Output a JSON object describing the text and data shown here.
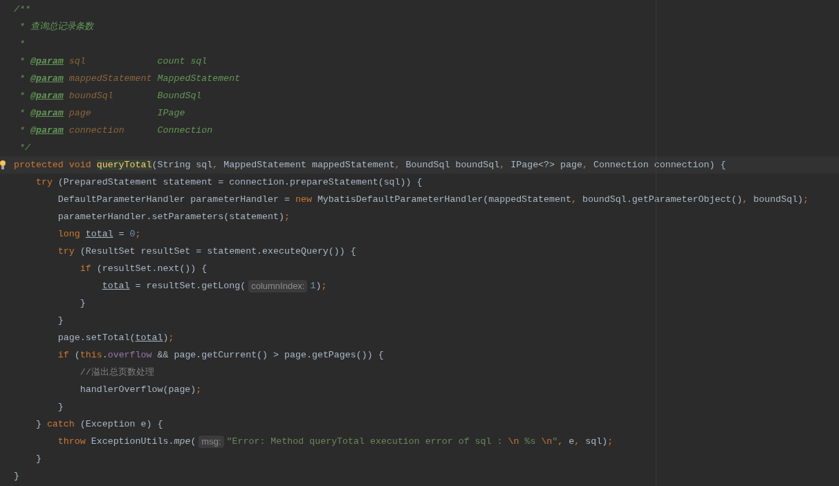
{
  "editor": {
    "lines": [
      {
        "current": false,
        "tokens": [
          {
            "text": "/**",
            "kind": "doc"
          }
        ]
      },
      {
        "current": false,
        "tokens": [
          {
            "text": " * 查询总记录条数",
            "kind": "doc"
          }
        ]
      },
      {
        "current": false,
        "tokens": [
          {
            "text": " *",
            "kind": "doc"
          }
        ]
      },
      {
        "current": false,
        "tokens": [
          {
            "text": " * ",
            "kind": "doc"
          },
          {
            "text": "@param",
            "kind": "tag"
          },
          {
            "text": " sql             ",
            "kind": "pname"
          },
          {
            "text": "count sql",
            "kind": "doc"
          }
        ]
      },
      {
        "current": false,
        "tokens": [
          {
            "text": " * ",
            "kind": "doc"
          },
          {
            "text": "@param",
            "kind": "tag"
          },
          {
            "text": " mappedStatement ",
            "kind": "pname"
          },
          {
            "text": "MappedStatement",
            "kind": "doc"
          }
        ]
      },
      {
        "current": false,
        "tokens": [
          {
            "text": " * ",
            "kind": "doc"
          },
          {
            "text": "@param",
            "kind": "tag"
          },
          {
            "text": " boundSql        ",
            "kind": "pname"
          },
          {
            "text": "BoundSql",
            "kind": "doc"
          }
        ]
      },
      {
        "current": false,
        "tokens": [
          {
            "text": " * ",
            "kind": "doc"
          },
          {
            "text": "@param",
            "kind": "tag"
          },
          {
            "text": " page            ",
            "kind": "pname"
          },
          {
            "text": "IPage",
            "kind": "doc"
          }
        ]
      },
      {
        "current": false,
        "tokens": [
          {
            "text": " * ",
            "kind": "doc"
          },
          {
            "text": "@param",
            "kind": "tag"
          },
          {
            "text": " connection      ",
            "kind": "pname"
          },
          {
            "text": "Connection",
            "kind": "doc"
          }
        ]
      },
      {
        "current": false,
        "tokens": [
          {
            "text": " */",
            "kind": "doc"
          }
        ]
      },
      {
        "current": true,
        "tokens": [
          {
            "text": "protected void ",
            "kind": "kw"
          },
          {
            "text": "queryTotal",
            "kind": "decl"
          },
          {
            "text": "(String sql",
            "kind": "plain"
          },
          {
            "text": ", ",
            "kind": "kw"
          },
          {
            "text": "MappedStatement mappedStatement",
            "kind": "plain"
          },
          {
            "text": ", ",
            "kind": "kw"
          },
          {
            "text": "BoundSql boundSql",
            "kind": "plain"
          },
          {
            "text": ", ",
            "kind": "kw"
          },
          {
            "text": "IPage<?> page",
            "kind": "plain"
          },
          {
            "text": ", ",
            "kind": "kw"
          },
          {
            "text": "Connection connection) {",
            "kind": "plain"
          }
        ]
      },
      {
        "current": false,
        "tokens": [
          {
            "text": "    try ",
            "kind": "kw"
          },
          {
            "text": "(PreparedStatement statement = connection.prepareStatement(sql)) {",
            "kind": "plain"
          }
        ]
      },
      {
        "current": false,
        "tokens": [
          {
            "text": "        DefaultParameterHandler parameterHandler = ",
            "kind": "plain"
          },
          {
            "text": "new ",
            "kind": "kw"
          },
          {
            "text": "MybatisDefaultParameterHandler(mappedStatement",
            "kind": "plain"
          },
          {
            "text": ", ",
            "kind": "kw"
          },
          {
            "text": "boundSql.getParameterObject()",
            "kind": "plain"
          },
          {
            "text": ", ",
            "kind": "kw"
          },
          {
            "text": "boundSql)",
            "kind": "plain"
          },
          {
            "text": ";",
            "kind": "kw"
          }
        ]
      },
      {
        "current": false,
        "tokens": [
          {
            "text": "        parameterHandler.setParameters(statement)",
            "kind": "plain"
          },
          {
            "text": ";",
            "kind": "kw"
          }
        ]
      },
      {
        "current": false,
        "tokens": [
          {
            "text": "        long ",
            "kind": "kw"
          },
          {
            "text": "total",
            "kind": "var"
          },
          {
            "text": " = ",
            "kind": "plain"
          },
          {
            "text": "0",
            "kind": "num"
          },
          {
            "text": ";",
            "kind": "kw"
          }
        ]
      },
      {
        "current": false,
        "tokens": [
          {
            "text": "        try ",
            "kind": "kw"
          },
          {
            "text": "(ResultSet resultSet = statement.executeQuery()) {",
            "kind": "plain"
          }
        ]
      },
      {
        "current": false,
        "tokens": [
          {
            "text": "            if ",
            "kind": "kw"
          },
          {
            "text": "(resultSet.next()) {",
            "kind": "plain"
          }
        ]
      },
      {
        "current": false,
        "tokens": [
          {
            "text": "                total",
            "kind": "var"
          },
          {
            "text": " = resultSet.getLong(",
            "kind": "plain"
          },
          {
            "text": "columnIndex:",
            "kind": "hint"
          },
          {
            "text": "1",
            "kind": "num"
          },
          {
            "text": ")",
            "kind": "plain"
          },
          {
            "text": ";",
            "kind": "kw"
          }
        ]
      },
      {
        "current": false,
        "tokens": [
          {
            "text": "            }",
            "kind": "plain"
          }
        ]
      },
      {
        "current": false,
        "tokens": [
          {
            "text": "        }",
            "kind": "plain"
          }
        ]
      },
      {
        "current": false,
        "tokens": [
          {
            "text": "        page.setTotal(",
            "kind": "plain"
          },
          {
            "text": "total",
            "kind": "var"
          },
          {
            "text": ")",
            "kind": "plain"
          },
          {
            "text": ";",
            "kind": "kw"
          }
        ]
      },
      {
        "current": false,
        "tokens": [
          {
            "text": "        if ",
            "kind": "kw"
          },
          {
            "text": "(",
            "kind": "plain"
          },
          {
            "text": "this",
            "kind": "kw"
          },
          {
            "text": ".",
            "kind": "plain"
          },
          {
            "text": "overflow",
            "kind": "field"
          },
          {
            "text": " && page.getCurrent() > page.getPages()) {",
            "kind": "plain"
          }
        ]
      },
      {
        "current": false,
        "tokens": [
          {
            "text": "            //溢出总页数处理",
            "kind": "comment"
          }
        ]
      },
      {
        "current": false,
        "tokens": [
          {
            "text": "            handlerOverflow(page)",
            "kind": "plain"
          },
          {
            "text": ";",
            "kind": "kw"
          }
        ]
      },
      {
        "current": false,
        "tokens": [
          {
            "text": "        }",
            "kind": "plain"
          }
        ]
      },
      {
        "current": false,
        "tokens": [
          {
            "text": "    } ",
            "kind": "plain"
          },
          {
            "text": "catch ",
            "kind": "kw"
          },
          {
            "text": "(Exception e) {",
            "kind": "plain"
          }
        ]
      },
      {
        "current": false,
        "tokens": [
          {
            "text": "        throw ",
            "kind": "kw"
          },
          {
            "text": "ExceptionUtils.",
            "kind": "plain"
          },
          {
            "text": "mpe",
            "kind": "static"
          },
          {
            "text": "(",
            "kind": "plain"
          },
          {
            "text": "msg:",
            "kind": "hint"
          },
          {
            "text": "\"Error: Method queryTotal execution error of sql : ",
            "kind": "str"
          },
          {
            "text": "\\n",
            "kind": "kw"
          },
          {
            "text": " %s ",
            "kind": "str"
          },
          {
            "text": "\\n",
            "kind": "kw"
          },
          {
            "text": "\"",
            "kind": "str"
          },
          {
            "text": ", ",
            "kind": "kw"
          },
          {
            "text": "e",
            "kind": "plain"
          },
          {
            "text": ", ",
            "kind": "kw"
          },
          {
            "text": "sql)",
            "kind": "plain"
          },
          {
            "text": ";",
            "kind": "kw"
          }
        ]
      },
      {
        "current": false,
        "tokens": [
          {
            "text": "    }",
            "kind": "plain"
          }
        ]
      },
      {
        "current": false,
        "tokens": [
          {
            "text": "}",
            "kind": "plain"
          }
        ]
      }
    ]
  }
}
